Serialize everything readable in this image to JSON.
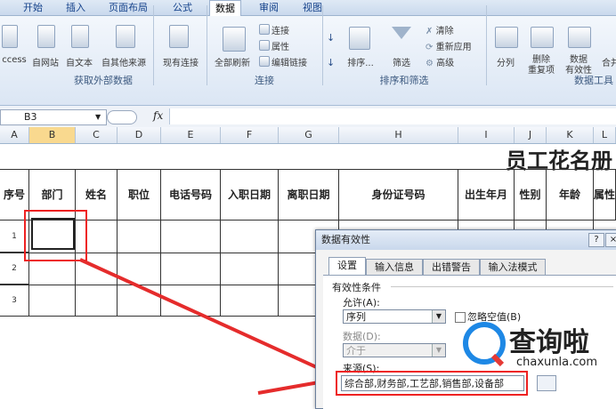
{
  "ribbon": {
    "tabs": [
      "开始",
      "插入",
      "页面布局",
      "公式",
      "数据",
      "审阅",
      "视图"
    ],
    "active_tab": "数据",
    "group_external": {
      "buttons": [
        "ccess",
        "自网站",
        "自文本",
        "自其他来源",
        "现有连接"
      ],
      "title": "获取外部数据"
    },
    "group_connections": {
      "refresh": "全部刷新",
      "small": [
        "连接",
        "属性",
        "编辑链接"
      ],
      "title": "连接"
    },
    "group_sort": {
      "sort": "排序...",
      "filter": "筛选",
      "small": [
        "清除",
        "重新应用",
        "高级"
      ],
      "title": "排序和筛选"
    },
    "group_tools": {
      "buttons": [
        "分列",
        "删除\n重复项",
        "数据\n有效性"
      ],
      "partial": "合并",
      "title": "数据工具"
    }
  },
  "formula_bar": {
    "name_box": "B3",
    "fx": "fx"
  },
  "columns": [
    "A",
    "B",
    "C",
    "D",
    "E",
    "F",
    "G",
    "H",
    "I",
    "J",
    "K",
    "L"
  ],
  "sheet": {
    "title": "员工花名册",
    "headers": [
      "序号",
      "部门",
      "姓名",
      "职位",
      "电话号码",
      "入职日期",
      "离职日期",
      "身份证号码",
      "出生年月",
      "性别",
      "年龄",
      "属性"
    ],
    "row_numbers": [
      "1",
      "2",
      "3"
    ]
  },
  "dialog": {
    "title": "数据有效性",
    "help": "?",
    "close": "×",
    "tabs": [
      "设置",
      "输入信息",
      "出错警告",
      "输入法模式"
    ],
    "conditions_label": "有效性条件",
    "allow_label": "允许(A):",
    "allow_value": "序列",
    "ignore_blank": "忽略空值(B)",
    "data_label": "数据(D):",
    "data_value": "介于",
    "source_label": "来源(S):",
    "source_value": "综合部,财务部,工艺部,销售部,设备部"
  },
  "watermark": {
    "text_cn": "查询啦",
    "text_en": "chaxunla.com"
  },
  "colors": {
    "accent": "#e52c2c",
    "ribbon": "#dbe6f4",
    "selected_col": "#f9d98f"
  }
}
